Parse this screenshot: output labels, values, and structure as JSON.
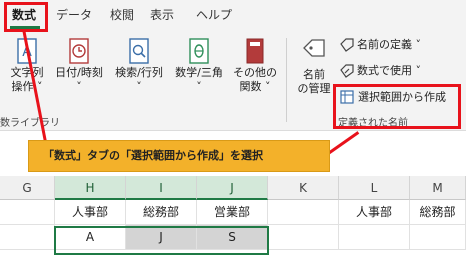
{
  "ribbon_tabs": [
    {
      "label": "数式",
      "active": true
    },
    {
      "label": "データ"
    },
    {
      "label": "校閲"
    },
    {
      "label": "表示"
    },
    {
      "label": "ヘルプ"
    }
  ],
  "library_commands": [
    {
      "line1": "文字列",
      "line2": "操作 ˅",
      "icon": "text-a-icon"
    },
    {
      "line1": "日付/時刻",
      "line2": "˅",
      "icon": "clock-icon"
    },
    {
      "line1": "検索/行列",
      "line2": "˅",
      "icon": "magnifier-icon"
    },
    {
      "line1": "数学/三角",
      "line2": "˅",
      "icon": "theta-icon"
    },
    {
      "line1": "その他の",
      "line2": "関数 ˅",
      "icon": "book-icon"
    }
  ],
  "library_group_label": "数ライブラリ",
  "name_manager": {
    "line1": "名前",
    "line2": "の管理"
  },
  "defined_names_commands": {
    "define_name": "名前の定義 ˅",
    "use_in_formula": "数式で使用 ˅",
    "create_from_selection": "選択範囲から作成"
  },
  "defined_names_group_label": "定義された名前",
  "callout_text": "「数式」タブの「選択範囲から作成」を選択",
  "columns": [
    "G",
    "H",
    "I",
    "J",
    "K",
    "L",
    "M"
  ],
  "selected_columns": [
    "H",
    "I",
    "J"
  ],
  "row1": [
    "",
    "人事部",
    "総務部",
    "営業部",
    "",
    "人事部",
    "総務部"
  ],
  "row2": [
    "",
    "A",
    "J",
    "S",
    "",
    "",
    ""
  ],
  "colors": {
    "accent_green": "#1f7a45",
    "highlight_red": "#e8121b",
    "callout_orange": "#f3b12a"
  }
}
